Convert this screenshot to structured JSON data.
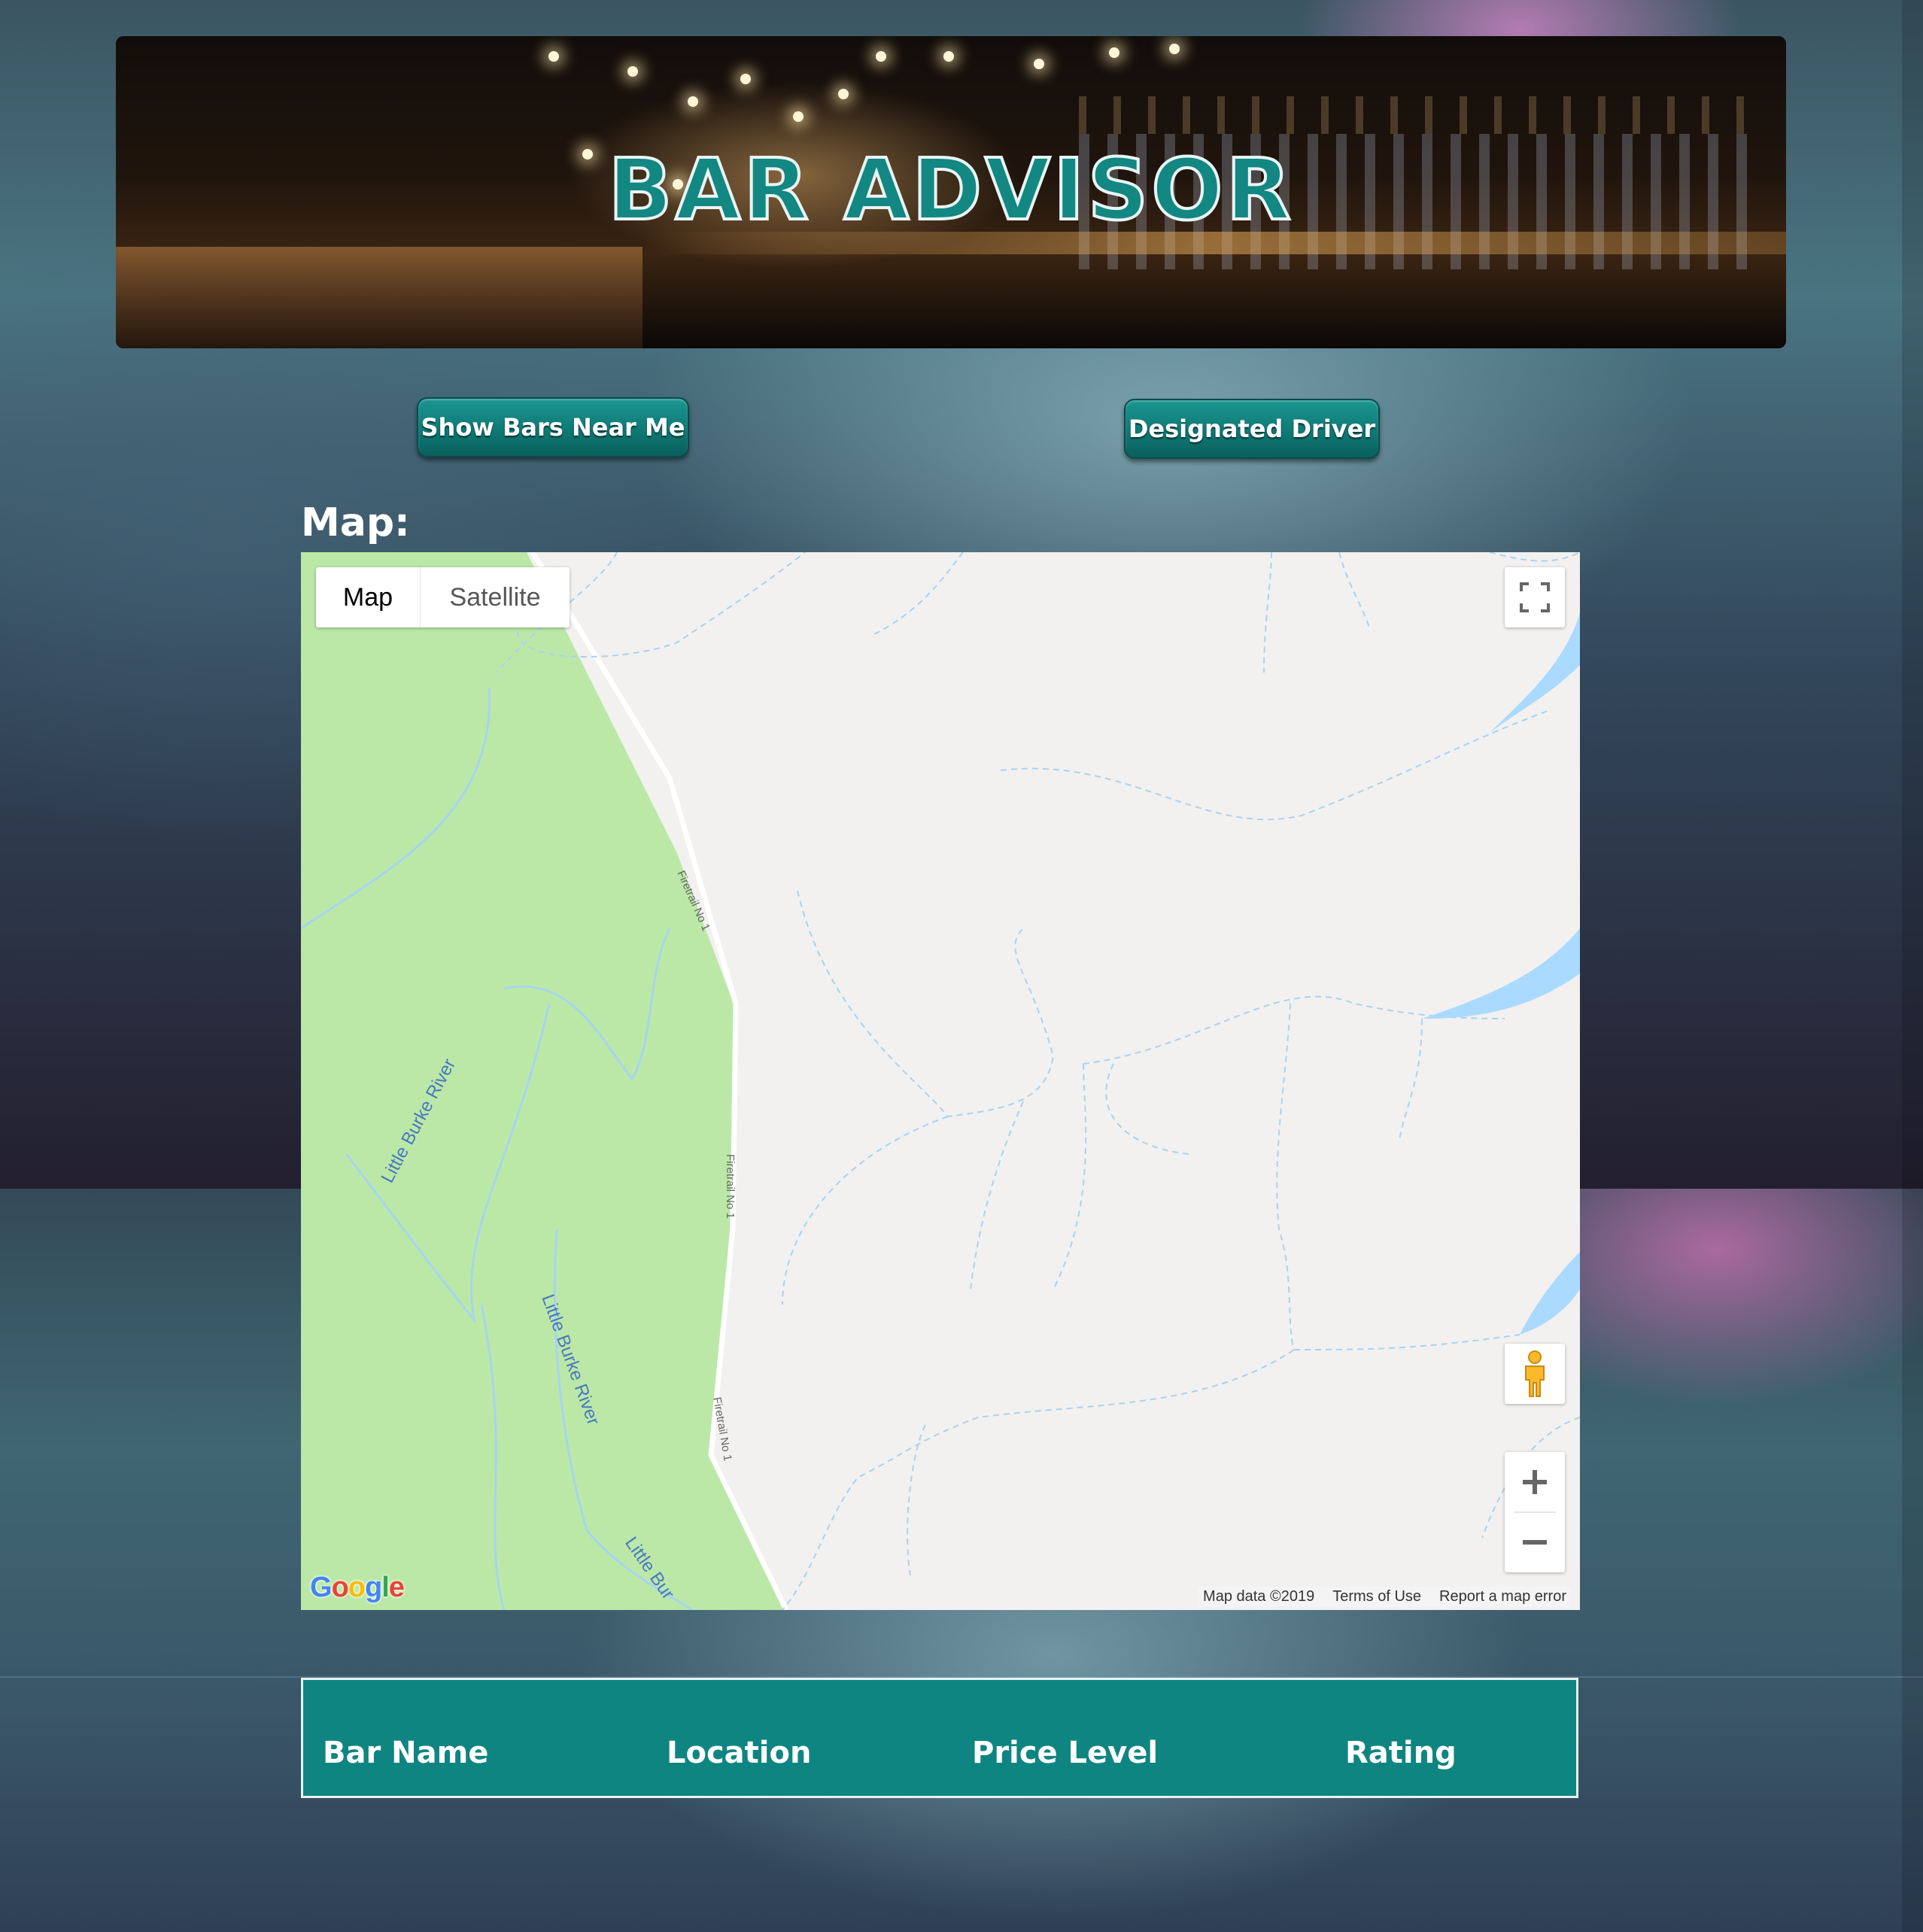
{
  "banner": {
    "title": "BAR ADVISOR"
  },
  "buttons": {
    "show_bars": "Show Bars Near Me",
    "designated_driver": "Designated Driver"
  },
  "map_section": {
    "heading": "Map:",
    "map_type": {
      "map": "Map",
      "satellite": "Satellite",
      "selected": "Map"
    },
    "labels": {
      "river1": "Little Burke River",
      "river2": "Little Burke River",
      "river3": "Little Bur",
      "road1": "Firetrail No 1",
      "road2": "Firetrail No 1",
      "road3": "Firetrail No 1"
    },
    "footer": {
      "map_data": "Map data ©2019",
      "terms": "Terms of Use",
      "report": "Report a map error"
    },
    "logo": "Google",
    "colors": {
      "land": "#f2f1f0",
      "park": "#bbe8a7",
      "water": "#aadaff",
      "stream": "#a9d3ef"
    }
  },
  "table": {
    "columns": [
      "Bar Name",
      "Location",
      "Price Level",
      "Rating"
    ],
    "rows": []
  },
  "colors": {
    "accent": "#0f8581",
    "button": "#138781"
  }
}
